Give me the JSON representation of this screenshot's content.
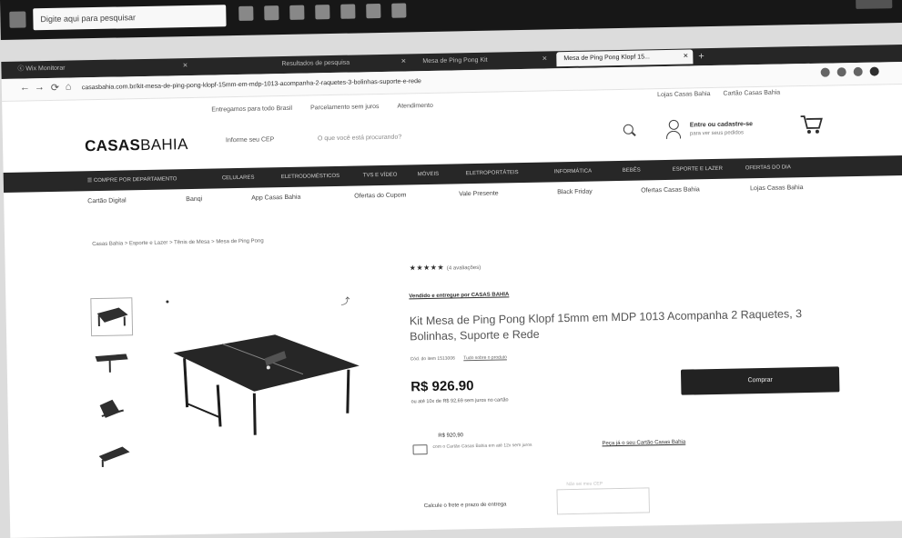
{
  "taskbar": {
    "search_text": "Digite aqui para pesquisar"
  },
  "browser": {
    "tabs": [
      {
        "label": "ⓒ Wix Monitorar"
      },
      {
        "label": "Resultados de pesquisa"
      },
      {
        "label": "Mesa de Ping Pong Kit"
      },
      {
        "label": "Mesa de Ping Pong Klopf 15...",
        "active": true
      }
    ],
    "new_tab": "+",
    "url": "casasbahia.com.br/kit-mesa-de-ping-pong-klopf-15mm-em-mdp-1013-acompanha-2-raquetes-3-bolinhas-suporte-e-rede",
    "back": "←",
    "forward": "→",
    "reload": "⟳",
    "home": "⌂"
  },
  "store": {
    "topstrip": [
      "Entregamos para todo Brasil",
      "Parcelamento sem juros",
      "Atendimento"
    ],
    "topstrip_right": [
      "Lojas Casas Bahia",
      "Cartão Casas Bahia"
    ],
    "logo_bold": "CASAS",
    "logo_light": "BAHIA",
    "cep_label": "Informe seu CEP",
    "search_placeholder": "O que você está procurando?",
    "login_line1": "Entre ou cadastre-se",
    "login_line2": "para ver seus pedidos",
    "categories": [
      "☰ COMPRE POR DEPARTAMENTO",
      "CELULARES",
      "ELETRODOMÉSTICOS",
      "TVS E VÍDEO",
      "MÓVEIS",
      "ELETROPORTÁTEIS",
      "INFORMÁTICA",
      "BEBÊS",
      "ESPORTE E LAZER",
      "OFERTAS DO DIA"
    ],
    "subnav": [
      "Cartão Digital",
      "Banqi",
      "App Casas Bahia",
      "Ofertas do Cupom",
      "Vale Presente",
      "Black Friday",
      "Ofertas Casas Bahia",
      "Lojas Casas Bahia"
    ],
    "breadcrumb": "Casas Bahia > Esporte e Lazer > Tênis de Mesa > Mesa de Ping Pong",
    "share_icon": "⤴"
  },
  "product": {
    "rating_stars": "★★★★★",
    "rating_count": "(4 avaliações)",
    "seller": "Vendido e entregue por CASAS BAHIA",
    "title": "Kit Mesa de Ping Pong Klopf 15mm em MDP 1013 Acompanha 2 Raquetes, 3 Bolinhas, Suporte e Rede",
    "code": "Cód. do item 1513006",
    "code_link": "Tudo sobre o produto",
    "price": "R$ 926.90",
    "installments": "ou até 10x de R$ 92,69 sem juros no cartão",
    "buy_label": "Comprar",
    "card_price": "R$ 920,90",
    "card_text": "com o Cartão Casas Bahia em até 12x sem juros",
    "card_link": "Peça já o seu Cartão Casas Bahia",
    "cep_prompt": "Calcule o frete e prazo de entrega",
    "cep_hint": "Não sei meu CEP"
  }
}
